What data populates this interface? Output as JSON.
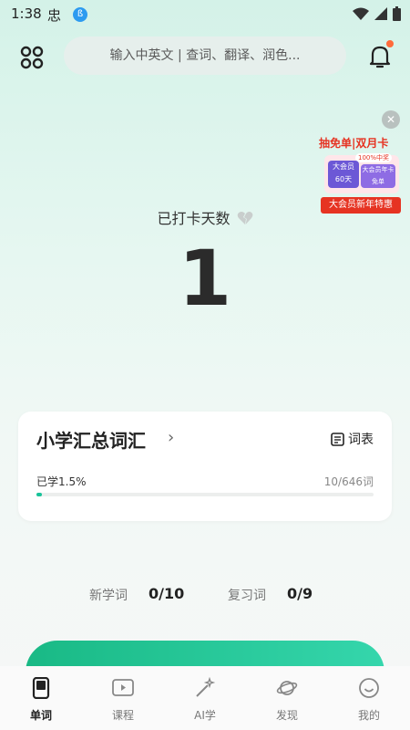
{
  "status": {
    "time": "1:38",
    "app_glyph": "忠",
    "blue_badge": "ß"
  },
  "header": {
    "search_placeholder": "输入中英文 | 查词、翻译、润色..."
  },
  "promo": {
    "top_text": "抽免单|双月卡",
    "badge": "100%中奖",
    "card1": "大会员60天",
    "card2": "大会员年卡免单",
    "bottom_text": "大会员新年特惠"
  },
  "checkin": {
    "label": "已打卡天数",
    "count": "1"
  },
  "vocab": {
    "title": "小学汇总词汇",
    "wordlist_label": "词表",
    "progress_label": "已学1.5%",
    "progress_count": "10/646词",
    "progress_fraction": 0.015
  },
  "stats": {
    "new_label": "新学词",
    "new_value": "0/10",
    "review_label": "复习词",
    "review_value": "0/9"
  },
  "tabs": [
    {
      "label": "单词",
      "icon": "phone-card-icon"
    },
    {
      "label": "课程",
      "icon": "video-play-icon"
    },
    {
      "label": "AI学",
      "icon": "magic-wand-icon"
    },
    {
      "label": "发现",
      "icon": "planet-icon"
    },
    {
      "label": "我的",
      "icon": "smile-face-icon"
    }
  ],
  "colors": {
    "accent": "#19c39a",
    "promo_red": "#e63322",
    "notification_dot": "#ff6a3a"
  }
}
